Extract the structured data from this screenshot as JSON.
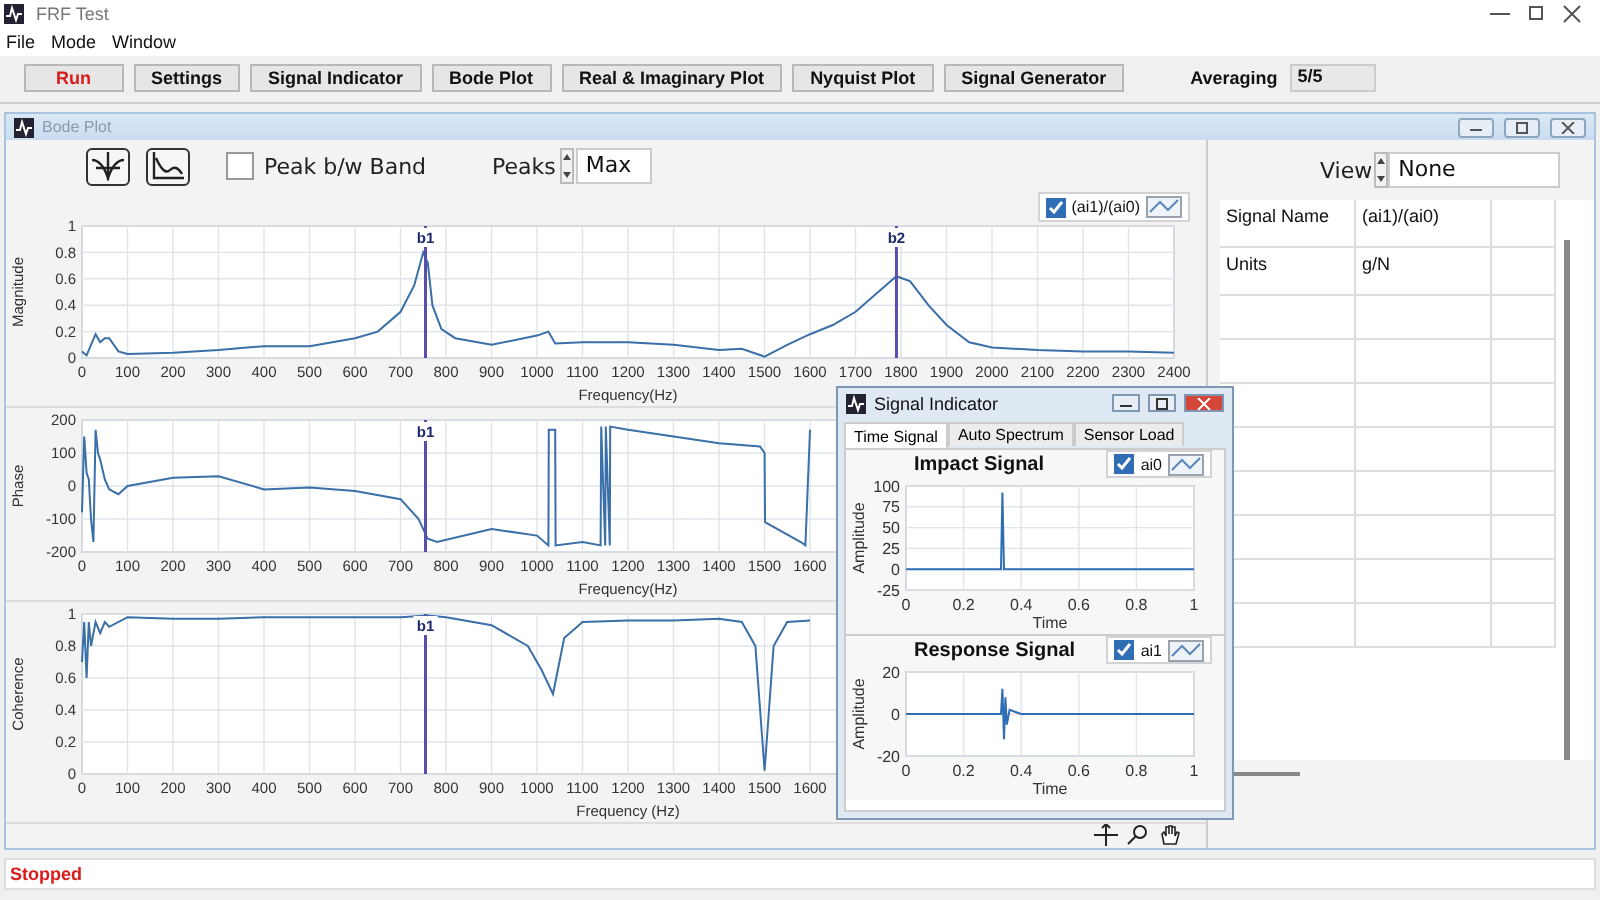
{
  "window": {
    "title": "FRF Test"
  },
  "menu": [
    "File",
    "Mode",
    "Window"
  ],
  "toolbar": {
    "buttons": [
      {
        "label": "Run",
        "kind": "run"
      },
      {
        "label": "Settings",
        "kind": "command"
      },
      {
        "label": "Signal Indicator",
        "kind": "command"
      },
      {
        "label": "Bode Plot",
        "kind": "command"
      },
      {
        "label": "Real & Imaginary Plot",
        "kind": "command"
      },
      {
        "label": "Nyquist Plot",
        "kind": "command"
      },
      {
        "label": "Signal Generator",
        "kind": "command"
      }
    ],
    "averaging": {
      "label": "Averaging",
      "value": "5/5"
    }
  },
  "bode_window": {
    "title": "Bode Plot",
    "peak_band": {
      "label": "Peak b/w Band",
      "checked": false
    },
    "peaks": {
      "label": "Peaks",
      "value": "Max"
    },
    "legend": {
      "checked": true
    },
    "charts": [
      {
        "chart_data": {
          "type": "line",
          "xlabel": "Frequency(Hz)",
          "ylabel": "Magnitude",
          "xlim": [
            0,
            2400
          ],
          "ylim": [
            0,
            1
          ],
          "xticks": [
            0,
            100,
            200,
            300,
            400,
            500,
            600,
            700,
            800,
            900,
            1000,
            1100,
            1200,
            1300,
            1400,
            1500,
            1600,
            1700,
            1800,
            1900,
            2000,
            2100,
            2200,
            2300,
            2400
          ],
          "yticks": [
            0,
            0.2,
            0.4,
            0.6,
            0.8,
            1
          ],
          "x": [
            0,
            10,
            20,
            30,
            40,
            50,
            60,
            80,
            100,
            200,
            300,
            400,
            500,
            600,
            650,
            700,
            730,
            750,
            760,
            770,
            790,
            820,
            900,
            1000,
            1025,
            1040,
            1100,
            1200,
            1300,
            1400,
            1450,
            1500,
            1550,
            1600,
            1650,
            1700,
            1750,
            1790,
            1820,
            1860,
            1900,
            1950,
            2000,
            2100,
            2200,
            2300,
            2400
          ],
          "series": [
            {
              "name": "(ai1)/(ai0)",
              "color": "#3a6fa8",
              "values": [
                0.05,
                0.02,
                0.1,
                0.18,
                0.12,
                0.15,
                0.15,
                0.05,
                0.03,
                0.04,
                0.06,
                0.09,
                0.09,
                0.15,
                0.2,
                0.35,
                0.55,
                0.8,
                0.72,
                0.4,
                0.22,
                0.15,
                0.1,
                0.17,
                0.2,
                0.11,
                0.12,
                0.12,
                0.1,
                0.06,
                0.07,
                0.01,
                0.1,
                0.18,
                0.25,
                0.35,
                0.5,
                0.62,
                0.58,
                0.4,
                0.25,
                0.12,
                0.08,
                0.06,
                0.05,
                0.05,
                0.04
              ]
            }
          ],
          "grid": true,
          "ref_lines": [
            {
              "axis": "x",
              "value": 755,
              "label": "b1"
            },
            {
              "axis": "x",
              "value": 1790,
              "label": "b2"
            }
          ]
        }
      },
      {
        "chart_data": {
          "type": "line",
          "xlabel": "Frequency(Hz)",
          "ylabel": "Phase",
          "xlim": [
            0,
            2400
          ],
          "ylim": [
            -200,
            200
          ],
          "xticks": [
            0,
            100,
            200,
            300,
            400,
            500,
            600,
            700,
            800,
            900,
            1000,
            1100,
            1200,
            1300,
            1400,
            1500,
            1600
          ],
          "yticks": [
            -200,
            -100,
            0,
            100,
            200
          ],
          "x": [
            0,
            5,
            10,
            15,
            20,
            25,
            30,
            35,
            40,
            50,
            60,
            80,
            100,
            200,
            300,
            400,
            500,
            600,
            700,
            740,
            760,
            780,
            900,
            1000,
            1025,
            1026,
            1040,
            1041,
            1100,
            1140,
            1141,
            1150,
            1151,
            1160,
            1161,
            1200,
            1300,
            1400,
            1490,
            1500,
            1501,
            1580,
            1590,
            1600
          ],
          "series": [
            {
              "color": "#3a6fa8",
              "values": [
                -80,
                150,
                40,
                20,
                -100,
                -170,
                170,
                100,
                80,
                20,
                -10,
                -25,
                0,
                25,
                30,
                -10,
                -5,
                -15,
                -40,
                -100,
                -160,
                -170,
                -130,
                -150,
                -180,
                170,
                170,
                -180,
                -170,
                -180,
                180,
                -180,
                180,
                -180,
                180,
                170,
                150,
                130,
                120,
                100,
                -110,
                -170,
                -180,
                170
              ]
            }
          ],
          "grid": true,
          "ref_lines": [
            {
              "axis": "x",
              "value": 755,
              "label": "b1"
            }
          ]
        }
      },
      {
        "chart_data": {
          "type": "line",
          "xlabel": "Frequency (Hz)",
          "ylabel": "Coherence",
          "xlim": [
            0,
            2400
          ],
          "ylim": [
            0,
            1
          ],
          "xticks": [
            0,
            100,
            200,
            300,
            400,
            500,
            600,
            700,
            800,
            900,
            1000,
            1100,
            1200,
            1300,
            1400,
            1500,
            1600
          ],
          "yticks": [
            0,
            0.2,
            0.4,
            0.6,
            0.8,
            1
          ],
          "x": [
            0,
            5,
            10,
            15,
            20,
            30,
            40,
            50,
            60,
            100,
            200,
            300,
            400,
            500,
            600,
            700,
            760,
            800,
            900,
            980,
            1010,
            1035,
            1060,
            1100,
            1200,
            1300,
            1400,
            1450,
            1480,
            1500,
            1520,
            1550,
            1600
          ],
          "series": [
            {
              "color": "#3a6fa8",
              "values": [
                0.7,
                0.95,
                0.6,
                0.95,
                0.8,
                0.95,
                0.88,
                0.95,
                0.92,
                0.98,
                0.97,
                0.97,
                0.98,
                0.98,
                0.98,
                0.98,
                0.99,
                0.98,
                0.93,
                0.8,
                0.65,
                0.5,
                0.85,
                0.95,
                0.96,
                0.96,
                0.97,
                0.95,
                0.8,
                0.02,
                0.8,
                0.95,
                0.96
              ]
            }
          ],
          "grid": true,
          "ref_lines": [
            {
              "axis": "x",
              "value": 755,
              "label": "b1"
            }
          ]
        }
      }
    ]
  },
  "right_panel": {
    "view": {
      "label": "View",
      "value": "None"
    },
    "rows": [
      {
        "name": "Signal Name",
        "value": "(ai1)/(ai0)"
      },
      {
        "name": "Units",
        "value": "g/N"
      }
    ]
  },
  "signal_indicator": {
    "title": "Signal Indicator",
    "tabs": [
      {
        "label": "Time Signal",
        "selected": true
      },
      {
        "label": "Auto Spectrum",
        "selected": false
      },
      {
        "label": "Sensor Load",
        "selected": false
      }
    ],
    "charts": [
      {
        "legend": {
          "checked": true
        },
        "chart_data": {
          "type": "line",
          "title": "Impact Signal",
          "xlabel": "Time",
          "ylabel": "Amplitude",
          "grid": true,
          "xlim": [
            0,
            1
          ],
          "ylim": [
            -25,
            100
          ],
          "xticks": [
            0,
            0.2,
            0.4,
            0.6,
            0.8,
            1
          ],
          "yticks": [
            -25,
            0,
            25,
            50,
            75,
            100
          ],
          "x": [
            0,
            0.33,
            0.335,
            0.34,
            0.345,
            1
          ],
          "series": [
            {
              "name": "ai0",
              "color": "#2f6db5",
              "values": [
                0,
                0,
                92,
                0,
                0,
                0
              ]
            }
          ]
        }
      },
      {
        "legend": {
          "checked": true
        },
        "chart_data": {
          "type": "line",
          "title": "Response Signal",
          "xlabel": "Time",
          "ylabel": "Amplitude",
          "grid": true,
          "xlim": [
            0,
            1
          ],
          "ylim": [
            -20,
            20
          ],
          "xticks": [
            0,
            0.2,
            0.4,
            0.6,
            0.8,
            1
          ],
          "yticks": [
            -20,
            0,
            20
          ],
          "x": [
            0,
            0.33,
            0.335,
            0.34,
            0.345,
            0.35,
            0.36,
            0.4,
            1
          ],
          "series": [
            {
              "name": "ai1",
              "color": "#2f6db5",
              "values": [
                0,
                0,
                12,
                -12,
                8,
                -5,
                2,
                0,
                0
              ]
            }
          ]
        }
      }
    ]
  },
  "status_bar": {
    "text": "Stopped"
  }
}
